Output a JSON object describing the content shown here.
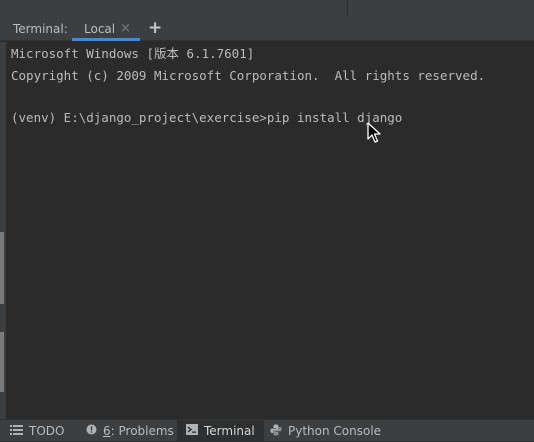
{
  "tabbar": {
    "title": "Terminal:",
    "tabs": [
      {
        "label": "Local",
        "close_glyph": "×",
        "active": true
      }
    ],
    "add_glyph": "+",
    "accent": "#4a88c7"
  },
  "terminal": {
    "lines": [
      "Microsoft Windows [版本 6.1.7601]",
      "Copyright (c) 2009 Microsoft Corporation.  All rights reserved.",
      "",
      "(venv) E:\\django_project\\exercise>pip install django"
    ],
    "background": "#2b2b2b",
    "foreground": "#bbbbbb"
  },
  "statusbar": {
    "items": [
      {
        "label": "TODO",
        "icon": "list-icon"
      },
      {
        "label_prefix": "6",
        "label": ": Problems",
        "icon": "warning-icon"
      },
      {
        "label": "Terminal",
        "icon": "terminal-icon",
        "active": true
      },
      {
        "label": "Python Console",
        "icon": "python-icon"
      }
    ]
  }
}
